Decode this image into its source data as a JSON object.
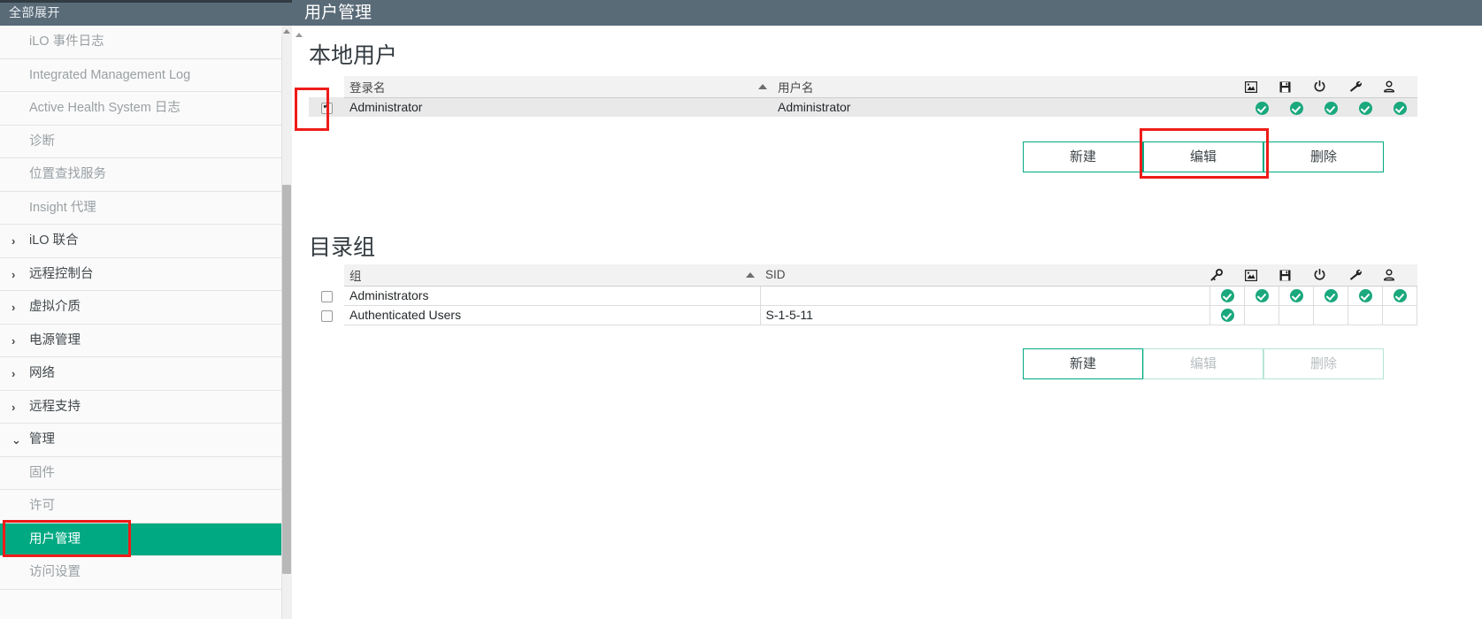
{
  "sidebar": {
    "header_label": "全部展开",
    "items": [
      {
        "label": "iLO 事件日志",
        "type": "sub"
      },
      {
        "label": "Integrated Management Log",
        "type": "sub"
      },
      {
        "label": "Active Health System 日志",
        "type": "sub"
      },
      {
        "label": "诊断",
        "type": "sub"
      },
      {
        "label": "位置查找服务",
        "type": "sub"
      },
      {
        "label": "Insight 代理",
        "type": "sub"
      },
      {
        "label": "iLO 联合",
        "type": "group",
        "chevron": "collapsed"
      },
      {
        "label": "远程控制台",
        "type": "group",
        "chevron": "collapsed"
      },
      {
        "label": "虚拟介质",
        "type": "group",
        "chevron": "collapsed"
      },
      {
        "label": "电源管理",
        "type": "group",
        "chevron": "collapsed"
      },
      {
        "label": "网络",
        "type": "group",
        "chevron": "collapsed"
      },
      {
        "label": "远程支持",
        "type": "group",
        "chevron": "collapsed"
      },
      {
        "label": "管理",
        "type": "group",
        "chevron": "expanded"
      },
      {
        "label": "固件",
        "type": "sub"
      },
      {
        "label": "许可",
        "type": "sub"
      },
      {
        "label": "用户管理",
        "type": "sub",
        "active": true
      },
      {
        "label": "访问设置",
        "type": "sub"
      }
    ],
    "chevron_collapsed_glyph": "›",
    "chevron_expanded_glyph": "⌄"
  },
  "topbar": {
    "title": "用户管理"
  },
  "local_users": {
    "title": "本地用户",
    "columns": [
      {
        "key": "check",
        "label": ""
      },
      {
        "key": "login",
        "label": "登录名",
        "sorted": true
      },
      {
        "key": "username",
        "label": "用户名"
      }
    ],
    "icon_columns": [
      {
        "name": "remote-console-icon"
      },
      {
        "name": "virtual-media-icon"
      },
      {
        "name": "power-icon"
      },
      {
        "name": "configure-settings-icon"
      },
      {
        "name": "administer-users-icon"
      }
    ],
    "rows": [
      {
        "checked": true,
        "login": "Administrator",
        "username": "Administrator",
        "privileges": [
          true,
          true,
          true,
          true,
          true
        ]
      }
    ],
    "buttons": [
      {
        "label": "新建",
        "enabled": true
      },
      {
        "label": "编辑",
        "enabled": true
      },
      {
        "label": "删除",
        "enabled": true
      }
    ]
  },
  "directory_groups": {
    "title": "目录组",
    "columns": [
      {
        "key": "check",
        "label": ""
      },
      {
        "key": "group",
        "label": "组",
        "sorted": true
      },
      {
        "key": "sid",
        "label": "SID"
      }
    ],
    "icon_columns": [
      {
        "name": "login-privilege-icon"
      },
      {
        "name": "remote-console-icon"
      },
      {
        "name": "virtual-media-icon"
      },
      {
        "name": "power-icon"
      },
      {
        "name": "configure-settings-icon"
      },
      {
        "name": "administer-users-icon"
      }
    ],
    "rows": [
      {
        "checked": false,
        "group": "Administrators",
        "sid": "",
        "privileges": [
          true,
          true,
          true,
          true,
          true,
          true
        ]
      },
      {
        "checked": false,
        "group": "Authenticated Users",
        "sid": "S-1-5-11",
        "privileges": [
          true,
          false,
          false,
          false,
          false,
          false
        ]
      }
    ],
    "buttons": [
      {
        "label": "新建",
        "enabled": true
      },
      {
        "label": "编辑",
        "enabled": false
      },
      {
        "label": "删除",
        "enabled": false
      }
    ]
  },
  "annotations": {
    "highlight_color": "#ee1c19",
    "boxes": [
      {
        "target": "row-checkbox"
      },
      {
        "target": "edit-button"
      },
      {
        "target": "sidebar-user-management"
      }
    ]
  },
  "colors": {
    "accent_green": "#00a982",
    "header_slate": "#5a6b78",
    "active_nav": "#00a982",
    "privilege_check": "#1aa87d"
  }
}
